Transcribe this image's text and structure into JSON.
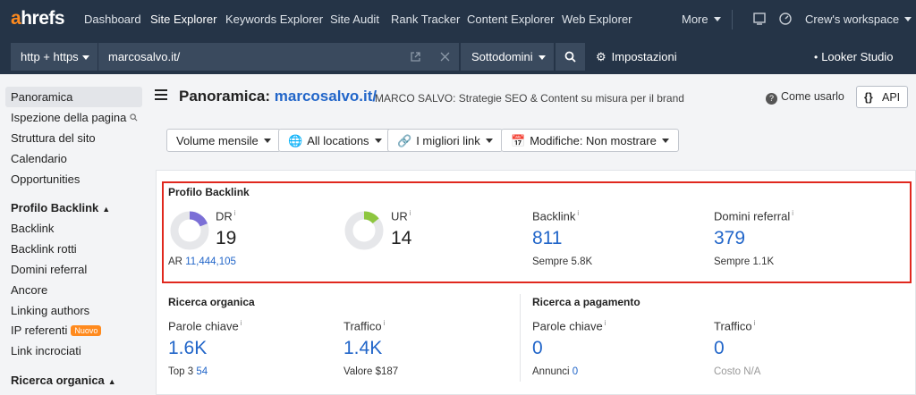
{
  "brand": {
    "logo_a": "a",
    "logo_rest": "hrefs"
  },
  "topnav": {
    "items": [
      "Dashboard",
      "Site Explorer",
      "Keywords Explorer",
      "Site Audit",
      "Rank Tracker",
      "Content Explorer",
      "Web Explorer"
    ],
    "more": "More",
    "workspace": "Crew's workspace"
  },
  "searchbar": {
    "protocol": "http + https",
    "target": "marcosalvo.it/",
    "mode": "Sottodomini",
    "settings": "Impostazioni",
    "looker": "Looker Studio"
  },
  "sidebar": {
    "items": [
      "Panoramica",
      "Ispezione della pagina",
      "Struttura del sito",
      "Calendario",
      "Opportunities"
    ],
    "backlink_head": "Profilo Backlink",
    "backlink_items": [
      "Backlink",
      "Backlink rotti",
      "Domini referral",
      "Ancore",
      "Linking authors",
      "IP referenti",
      "Link incrociati"
    ],
    "new_badge": "Nuovo",
    "organic_head": "Ricerca organica"
  },
  "page": {
    "title_prefix": "Panoramica:",
    "title_domain": "marcosalvo.it/",
    "subtitle": "MARCO SALVO: Strategie SEO & Content su misura per il brand",
    "help": "Come usarlo",
    "api": "API"
  },
  "filters": [
    "Volume mensile",
    "All locations",
    "I migliori link",
    "Modifiche: Non mostrare"
  ],
  "backlink_profile": {
    "title": "Profilo Backlink",
    "dr": {
      "label": "DR",
      "value": "19",
      "fill": 0.19,
      "color": "#7b6fd6"
    },
    "ar_label": "AR",
    "ar_value": "11,444,105",
    "ur": {
      "label": "UR",
      "value": "14",
      "fill": 0.14,
      "color": "#8dc63f"
    },
    "backlink": {
      "label": "Backlink",
      "value": "811",
      "sub_label": "Sempre",
      "sub_value": "5.8K"
    },
    "domains": {
      "label": "Domini referral",
      "value": "379",
      "sub_label": "Sempre",
      "sub_value": "1.1K"
    }
  },
  "organic": {
    "title": "Ricerca organica",
    "keywords": {
      "label": "Parole chiave",
      "value": "1.6K",
      "sub_label": "Top 3",
      "sub_value": "54"
    },
    "traffic": {
      "label": "Traffico",
      "value": "1.4K",
      "sub_label": "Valore",
      "sub_value": "$187"
    }
  },
  "paid": {
    "title": "Ricerca a pagamento",
    "keywords": {
      "label": "Parole chiave",
      "value": "0",
      "sub_label": "Annunci",
      "sub_value": "0"
    },
    "traffic": {
      "label": "Traffico",
      "value": "0",
      "sub_label": "Costo",
      "sub_value": "N/A"
    }
  },
  "info_mark": "i",
  "colors": {
    "nav_bg": "#253447",
    "accent_orange": "#ff8a1e",
    "link_blue": "#2266c9",
    "highlight_red": "#e0281e"
  }
}
